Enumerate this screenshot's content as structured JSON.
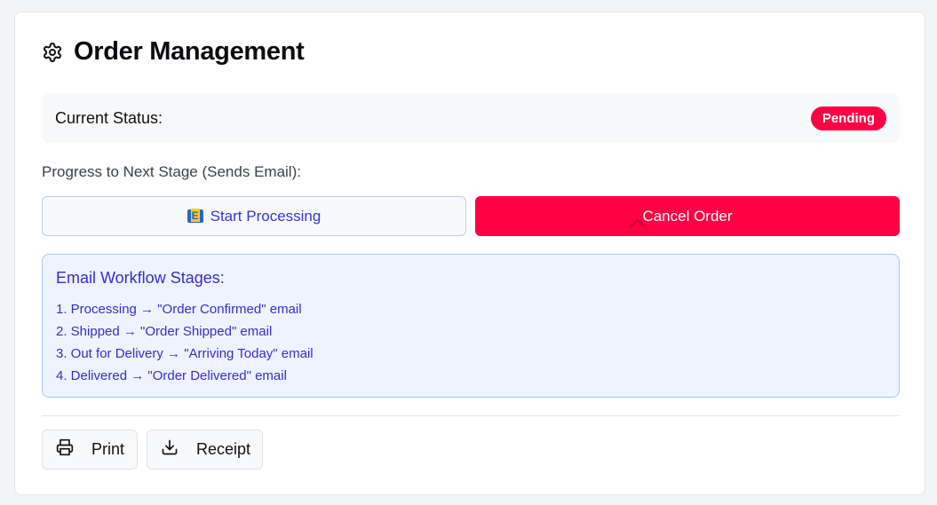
{
  "header": {
    "title": "Order Management",
    "icon": "gear-icon"
  },
  "status": {
    "label": "Current Status:",
    "value": "Pending",
    "badge_color": "#ff0044"
  },
  "progress": {
    "label": "Progress to Next Stage (Sends Email):",
    "start_button": "Start Processing",
    "cancel_button": "Cancel Order"
  },
  "workflow": {
    "title": "Email Workflow Stages:",
    "stages": [
      "1. Processing → \"Order Confirmed\" email",
      "2. Shipped → \"Order Shipped\" email",
      "3. Out for Delivery → \"Arriving Today\" email",
      "4. Delivered → \"Order Delivered\" email"
    ]
  },
  "actions": {
    "print_label": "Print",
    "receipt_label": "Receipt"
  },
  "colors": {
    "accent_red": "#ff0044",
    "link_blue": "#3535d6",
    "workflow_bg": "#edf4ff"
  }
}
